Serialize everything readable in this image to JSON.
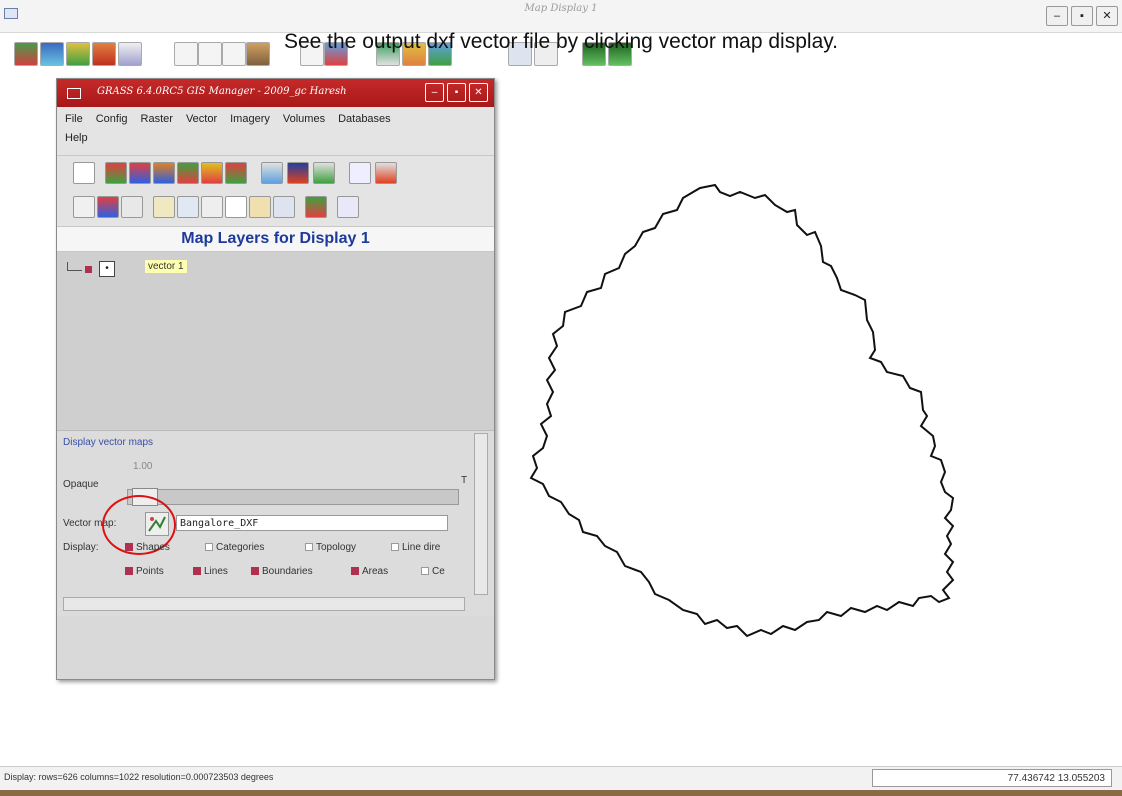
{
  "window": {
    "title": "Map Display 1",
    "controls": [
      "–",
      "▪",
      "✕"
    ]
  },
  "caption": "See the output dxf vector file by clicking vector map display.",
  "layer_manager": {
    "title": "GRASS 6.4.0RC5 GIS Manager - 2009_gc Haresh",
    "menu_row1": [
      "File",
      "Config",
      "Raster",
      "Vector",
      "Imagery",
      "Volumes",
      "Databases"
    ],
    "menu_row2": [
      "Help"
    ],
    "map_layers_heading": "Map Layers for Display 1",
    "layer": {
      "name": "vector 1",
      "type_glyph": "•"
    },
    "options": {
      "section_label": "Display vector maps",
      "opaque_label": "Opaque",
      "opacity_value": "1.00",
      "t_label": "T",
      "vector_map_label": "Vector map:",
      "vector_map_value": "Bangalore_DXF",
      "display_label": "Display:",
      "display_row1": [
        {
          "label": "Shapes",
          "checked": true
        },
        {
          "label": "Categories",
          "checked": false
        },
        {
          "label": "Topology",
          "checked": false
        },
        {
          "label": "Line dire",
          "checked": false
        }
      ],
      "display_row2": [
        {
          "label": "Points",
          "checked": true
        },
        {
          "label": "Lines",
          "checked": true
        },
        {
          "label": "Boundaries",
          "checked": true
        },
        {
          "label": "Areas",
          "checked": true
        },
        {
          "label": "Ce",
          "checked": false
        }
      ]
    }
  },
  "status": {
    "text": "Display: rows=626 columns=1022 resolution=0.000723503 degrees",
    "coordinates": "77.436742 13.055203"
  },
  "colors": {
    "gm_title": "#b82020",
    "map_layers_heading": "#1d3a9a",
    "highlight_circle": "#dd1111",
    "boundary": "#111111"
  }
}
